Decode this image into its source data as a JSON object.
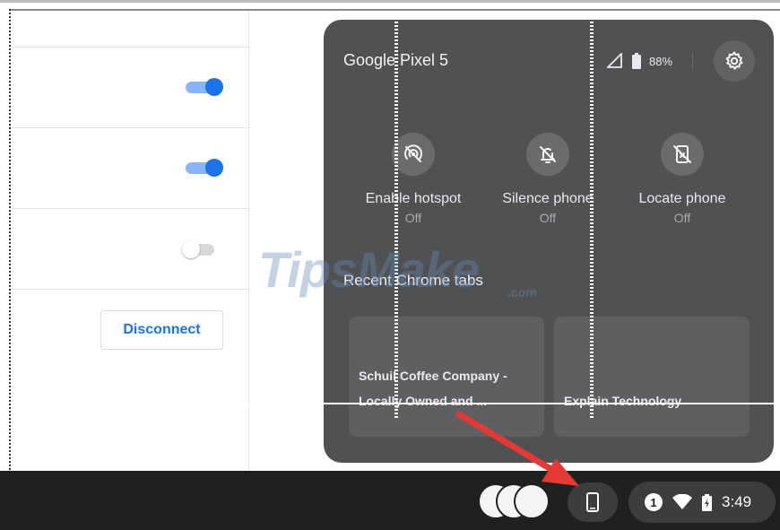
{
  "settings": {
    "toggles": [
      {
        "name": "toggle-1",
        "state": "on"
      },
      {
        "name": "toggle-2",
        "state": "on"
      },
      {
        "name": "toggle-3",
        "state": "off"
      }
    ],
    "disconnect_label": "Disconnect"
  },
  "phone_hub": {
    "device_name": "Google Pixel 5",
    "battery_percent": "88%",
    "features": [
      {
        "label": "Enable hotspot",
        "state": "Off",
        "icon": "hotspot-off-icon"
      },
      {
        "label": "Silence phone",
        "state": "Off",
        "icon": "silence-phone-icon"
      },
      {
        "label": "Locate phone",
        "state": "Off",
        "icon": "locate-phone-icon"
      }
    ],
    "recent_tabs_heading": "Recent Chrome tabs",
    "tabs": [
      {
        "title_line1": "Schuil Coffee Company -",
        "title_line2": "Locally Owned and ..."
      },
      {
        "title_line1": "Explain Technology"
      }
    ]
  },
  "watermark": {
    "text": "TipsMake",
    "suffix": ".com"
  },
  "shelf": {
    "notification_count": "1",
    "time": "3:49"
  },
  "colors": {
    "panel_bg": "#505152",
    "shelf_bg": "#1f2022",
    "accent_blue": "#1a73e8",
    "arrow_red": "#e53935"
  }
}
